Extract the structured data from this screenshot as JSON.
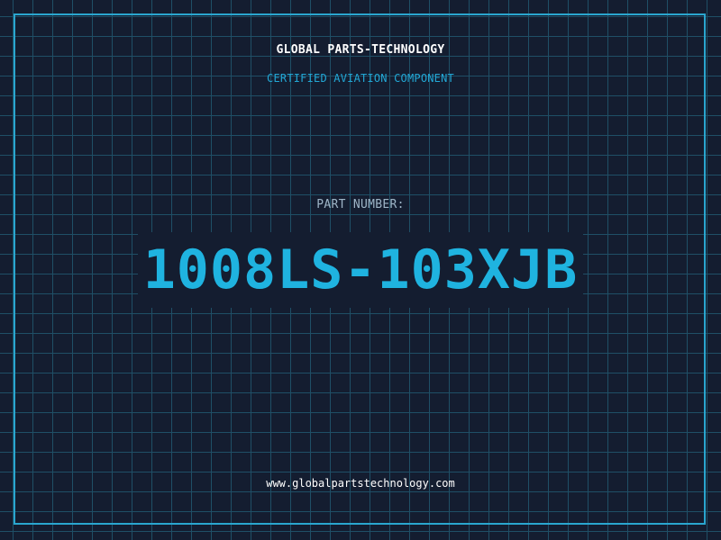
{
  "label": {
    "company": "GLOBAL PARTS-TECHNOLOGY",
    "subtitle": "CERTIFIED AVIATION COMPONENT",
    "part_label": "PART NUMBER:",
    "part_number": "1008LS-103XJB",
    "website": "www.globalpartstechnology.com"
  },
  "colors": {
    "background": "#141d30",
    "grid": "#1f4f66",
    "frame": "#2aa6cf",
    "accent": "#1fb3e0",
    "text": "#ffffff"
  }
}
